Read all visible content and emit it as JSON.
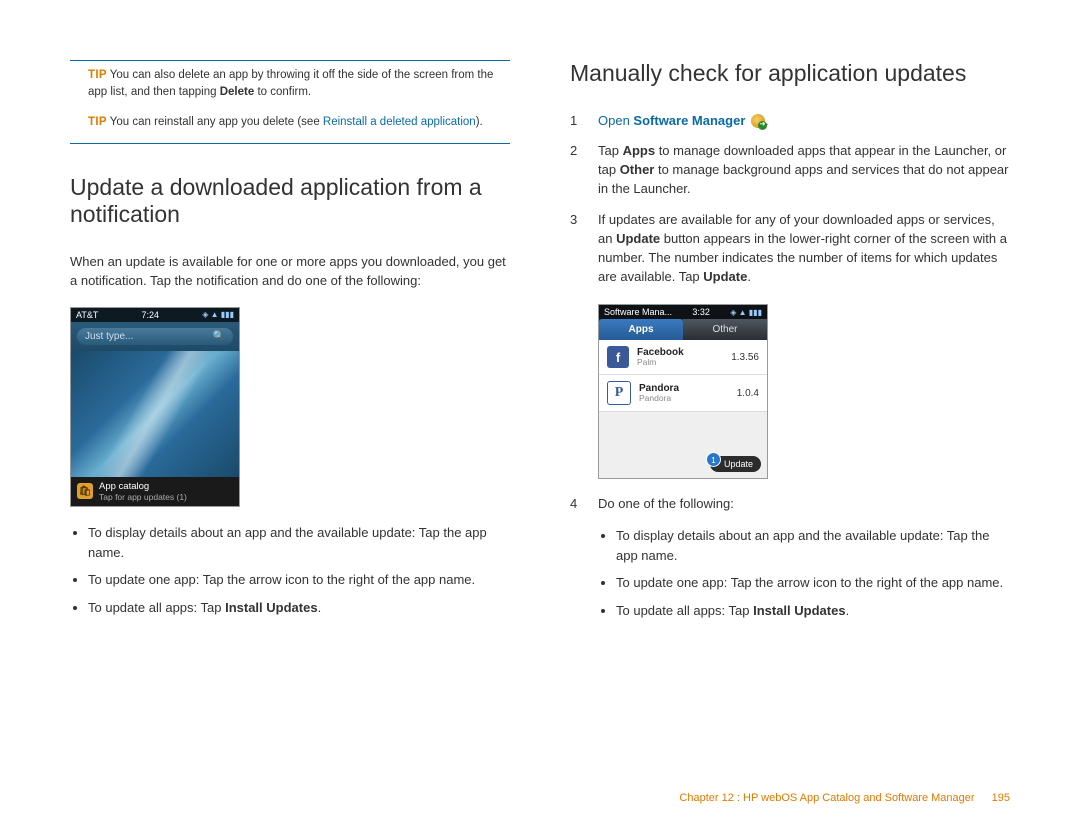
{
  "left": {
    "tip1": {
      "label": "TIP",
      "text_a": "You can also delete an app by throwing it off the side of the screen from the app list, and then tapping ",
      "bold": "Delete",
      "text_b": " to confirm."
    },
    "tip2": {
      "label": "TIP",
      "text_a": "You can reinstall any app you delete (see ",
      "link": "Reinstall a deleted application",
      "text_b": ")."
    },
    "heading": "Update a downloaded application from a notification",
    "intro": "When an update is available for one or more apps you downloaded, you get a notification. Tap the notification and do one of the following:",
    "phone": {
      "carrier": "AT&T",
      "time": "7:24",
      "search_placeholder": "Just type...",
      "notif_title": "App catalog",
      "notif_sub": "Tap for app updates (1)"
    },
    "bullets": {
      "b1": "To display details about an app and the available update: Tap the app name.",
      "b2": "To update one app: Tap the arrow icon to the right of the app name.",
      "b3_a": "To update all apps: Tap ",
      "b3_bold": "Install Updates",
      "b3_b": "."
    }
  },
  "right": {
    "heading": "Manually check for application updates",
    "steps": {
      "s1_num": "1",
      "s1_open": "Open",
      "s1_bold": " Software Manager ",
      "s2_num": "2",
      "s2_a": "Tap ",
      "s2_b1": "Apps",
      "s2_b": " to manage downloaded apps that appear in the Launcher, or tap ",
      "s2_b2": "Other",
      "s2_c": " to manage background apps and services that do not appear in the Launcher.",
      "s3_num": "3",
      "s3_a": "If updates are available for any of your downloaded apps or services, an ",
      "s3_b1": "Update",
      "s3_b": " button appears in the lower-right corner of the screen with a number. The number indicates the number of items for which updates are available. Tap ",
      "s3_b2": "Update",
      "s3_c": ".",
      "s4_num": "4",
      "s4": "Do one of the following:"
    },
    "phone": {
      "title": "Software Mana...",
      "time": "3:32",
      "tab_apps": "Apps",
      "tab_other": "Other",
      "app1_name": "Facebook",
      "app1_pub": "Palm",
      "app1_ver": "1.3.56",
      "app2_name": "Pandora",
      "app2_pub": "Pandora",
      "app2_ver": "1.0.4",
      "update_label": "Update",
      "update_count": "1"
    },
    "bullets": {
      "b1": "To display details about an app and the available update: Tap the app name.",
      "b2": "To update one app: Tap the arrow icon to the right of the app name.",
      "b3_a": "To update all apps: Tap ",
      "b3_bold": "Install Updates",
      "b3_b": "."
    }
  },
  "footer": {
    "chapter": "Chapter 12  :  HP webOS App Catalog and Software Manager",
    "page": "195"
  }
}
